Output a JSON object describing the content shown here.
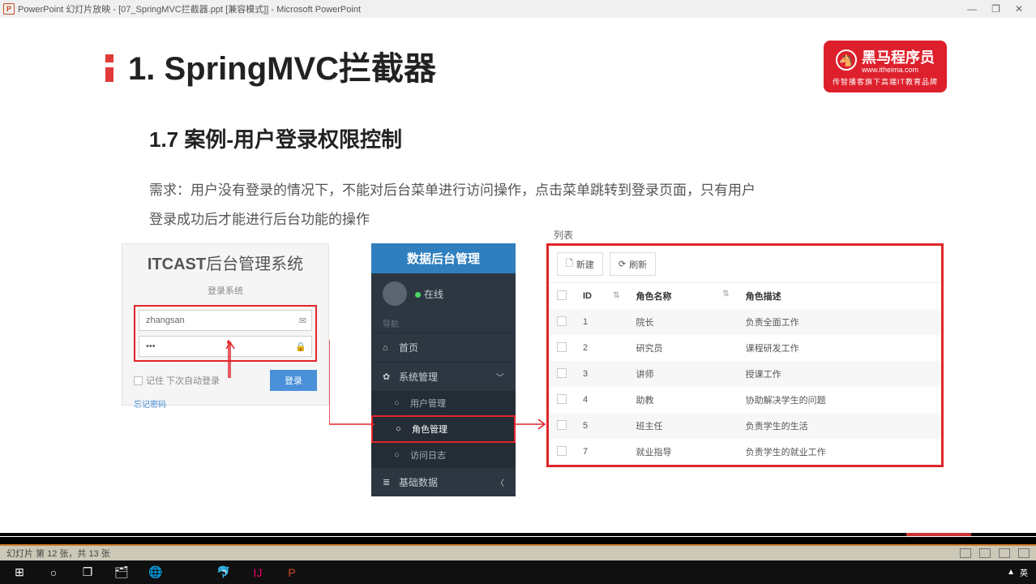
{
  "window": {
    "title": "PowerPoint 幻灯片放映 - [07_SpringMVC拦截器.ppt [兼容模式]] - Microsoft PowerPoint",
    "minimize": "—",
    "maximize": "❐",
    "close": "✕"
  },
  "slide": {
    "heading": "1. SpringMVC拦截器",
    "subtitle": "1.7 案例-用户登录权限控制",
    "requirement": "需求：用户没有登录的情况下，不能对后台菜单进行访问操作，点击菜单跳转到登录页面，只有用户登录成功后才能进行后台功能的操作"
  },
  "logo": {
    "brand": "黑马程序员",
    "url": "www.itheima.com",
    "slogan": "传智播客旗下高端IT教育品牌"
  },
  "login": {
    "header_strong": "ITCAST",
    "header_rest": "后台管理系统",
    "subtitle": "登录系统",
    "username": "zhangsan",
    "password": "•••",
    "remember": "记住 下次自动登录",
    "button": "登录",
    "forgot": "忘记密码"
  },
  "sidebar": {
    "title": "数据后台管理",
    "online": "在线",
    "nav_label": "导航",
    "items": {
      "home": "首页",
      "system": "系统管理",
      "user": "用户管理",
      "role": "角色管理",
      "log": "访问日志",
      "base": "基础数据"
    }
  },
  "table": {
    "list_label": "列表",
    "new_btn": "新建",
    "refresh_btn": "刷新",
    "cols": {
      "id": "ID",
      "name": "角色名称",
      "desc": "角色描述"
    },
    "rows": [
      {
        "id": "1",
        "name": "院长",
        "desc": "负责全面工作"
      },
      {
        "id": "2",
        "name": "研究员",
        "desc": "课程研发工作"
      },
      {
        "id": "3",
        "name": "讲师",
        "desc": "授课工作"
      },
      {
        "id": "4",
        "name": "助教",
        "desc": "协助解决学生的问题"
      },
      {
        "id": "5",
        "name": "班主任",
        "desc": "负责学生的生活"
      },
      {
        "id": "7",
        "name": "就业指导",
        "desc": "负责学生的就业工作"
      }
    ]
  },
  "status": {
    "slide_info": "幻灯片 第 12 张，共 13 张",
    "ime": "英"
  },
  "taskbar": {
    "tray_up": "▲"
  }
}
